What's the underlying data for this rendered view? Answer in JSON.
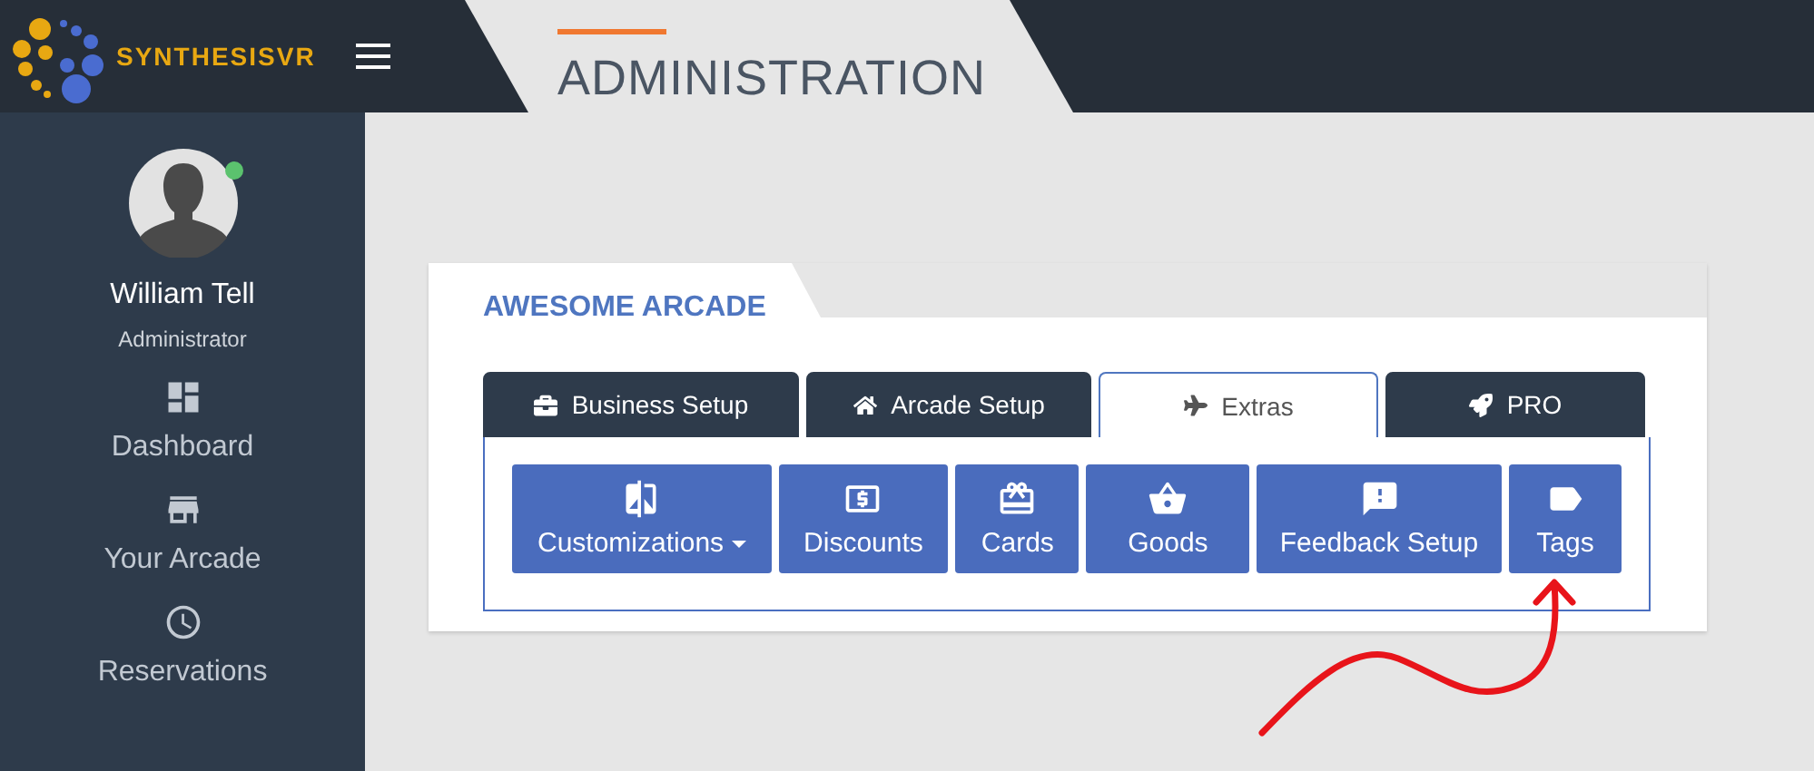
{
  "header": {
    "logo": "SYNTHESISVR",
    "page_title": "ADMINISTRATION"
  },
  "user": {
    "name": "William Tell",
    "role": "Administrator",
    "online": true
  },
  "sidebar": {
    "items": [
      {
        "label": "Dashboard",
        "kind": "dashboard"
      },
      {
        "label": "Your Arcade",
        "kind": "store"
      },
      {
        "label": "Reservations",
        "kind": "clock"
      }
    ]
  },
  "card": {
    "title": "AWESOME ARCADE",
    "tabs": [
      {
        "label": "Business Setup",
        "kind": "briefcase",
        "selected": false
      },
      {
        "label": "Arcade Setup",
        "kind": "home",
        "selected": false
      },
      {
        "label": "Extras",
        "kind": "plane",
        "selected": true
      },
      {
        "label": "PRO",
        "kind": "rocket",
        "selected": false
      }
    ],
    "buttons": [
      {
        "label": "Customizations",
        "kind": "compare",
        "dropdown": true
      },
      {
        "label": "Discounts",
        "kind": "money",
        "dropdown": false
      },
      {
        "label": "Cards",
        "kind": "gift",
        "dropdown": false
      },
      {
        "label": "Goods",
        "kind": "basket",
        "dropdown": false
      },
      {
        "label": "Feedback Setup",
        "kind": "feedback",
        "dropdown": false
      },
      {
        "label": "Tags",
        "kind": "tag",
        "dropdown": false
      }
    ]
  }
}
